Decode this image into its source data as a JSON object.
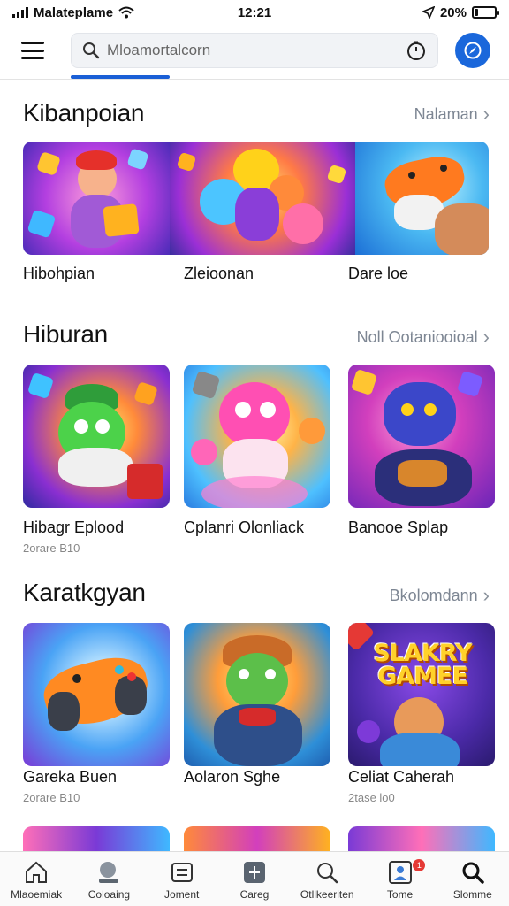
{
  "status_bar": {
    "carrier": "Malateplame",
    "time": "12:21",
    "battery": "20%",
    "battery_level": 0.2
  },
  "search": {
    "placeholder": "Mloamortalcorn"
  },
  "sections": [
    {
      "title": "Kibanpoian",
      "link": "Nalaman",
      "items": [
        {
          "title": "Hibohpian"
        },
        {
          "title": "Zleioonan"
        },
        {
          "title": "Dare loe"
        }
      ]
    },
    {
      "title": "Hiburan",
      "link": "Noll Ootaniooioal",
      "items": [
        {
          "title": "Hibagr Eplood",
          "sub": "2orare B10"
        },
        {
          "title": "Cplanri Olonliack",
          "sub": ""
        },
        {
          "title": "Banooe Splap",
          "sub": ""
        }
      ]
    },
    {
      "title": "Karatkgyan",
      "link": "Bkolomdann",
      "items": [
        {
          "title": "Gareka Buen",
          "sub": "2orare B10"
        },
        {
          "title": "Aolaron Sghe",
          "sub": ""
        },
        {
          "title": "Celiat Caherah",
          "sub": "2tase lo0",
          "poster": "SLAKRY GAMEE"
        }
      ]
    }
  ],
  "bottom_nav": [
    {
      "label": "Mlaoemiak",
      "icon": "home-icon"
    },
    {
      "label": "Coloaing",
      "icon": "search-circle-icon"
    },
    {
      "label": "Joment",
      "icon": "doc-icon"
    },
    {
      "label": "Careg",
      "icon": "tool-icon"
    },
    {
      "label": "Otllkeeriten",
      "icon": "search-icon"
    },
    {
      "label": "Tome",
      "icon": "profile-icon",
      "badge": "1"
    },
    {
      "label": "Slomme",
      "icon": "search-bold-icon"
    }
  ],
  "colors": {
    "accent": "#1a67db",
    "link": "#7d8693",
    "badge": "#e53935"
  }
}
